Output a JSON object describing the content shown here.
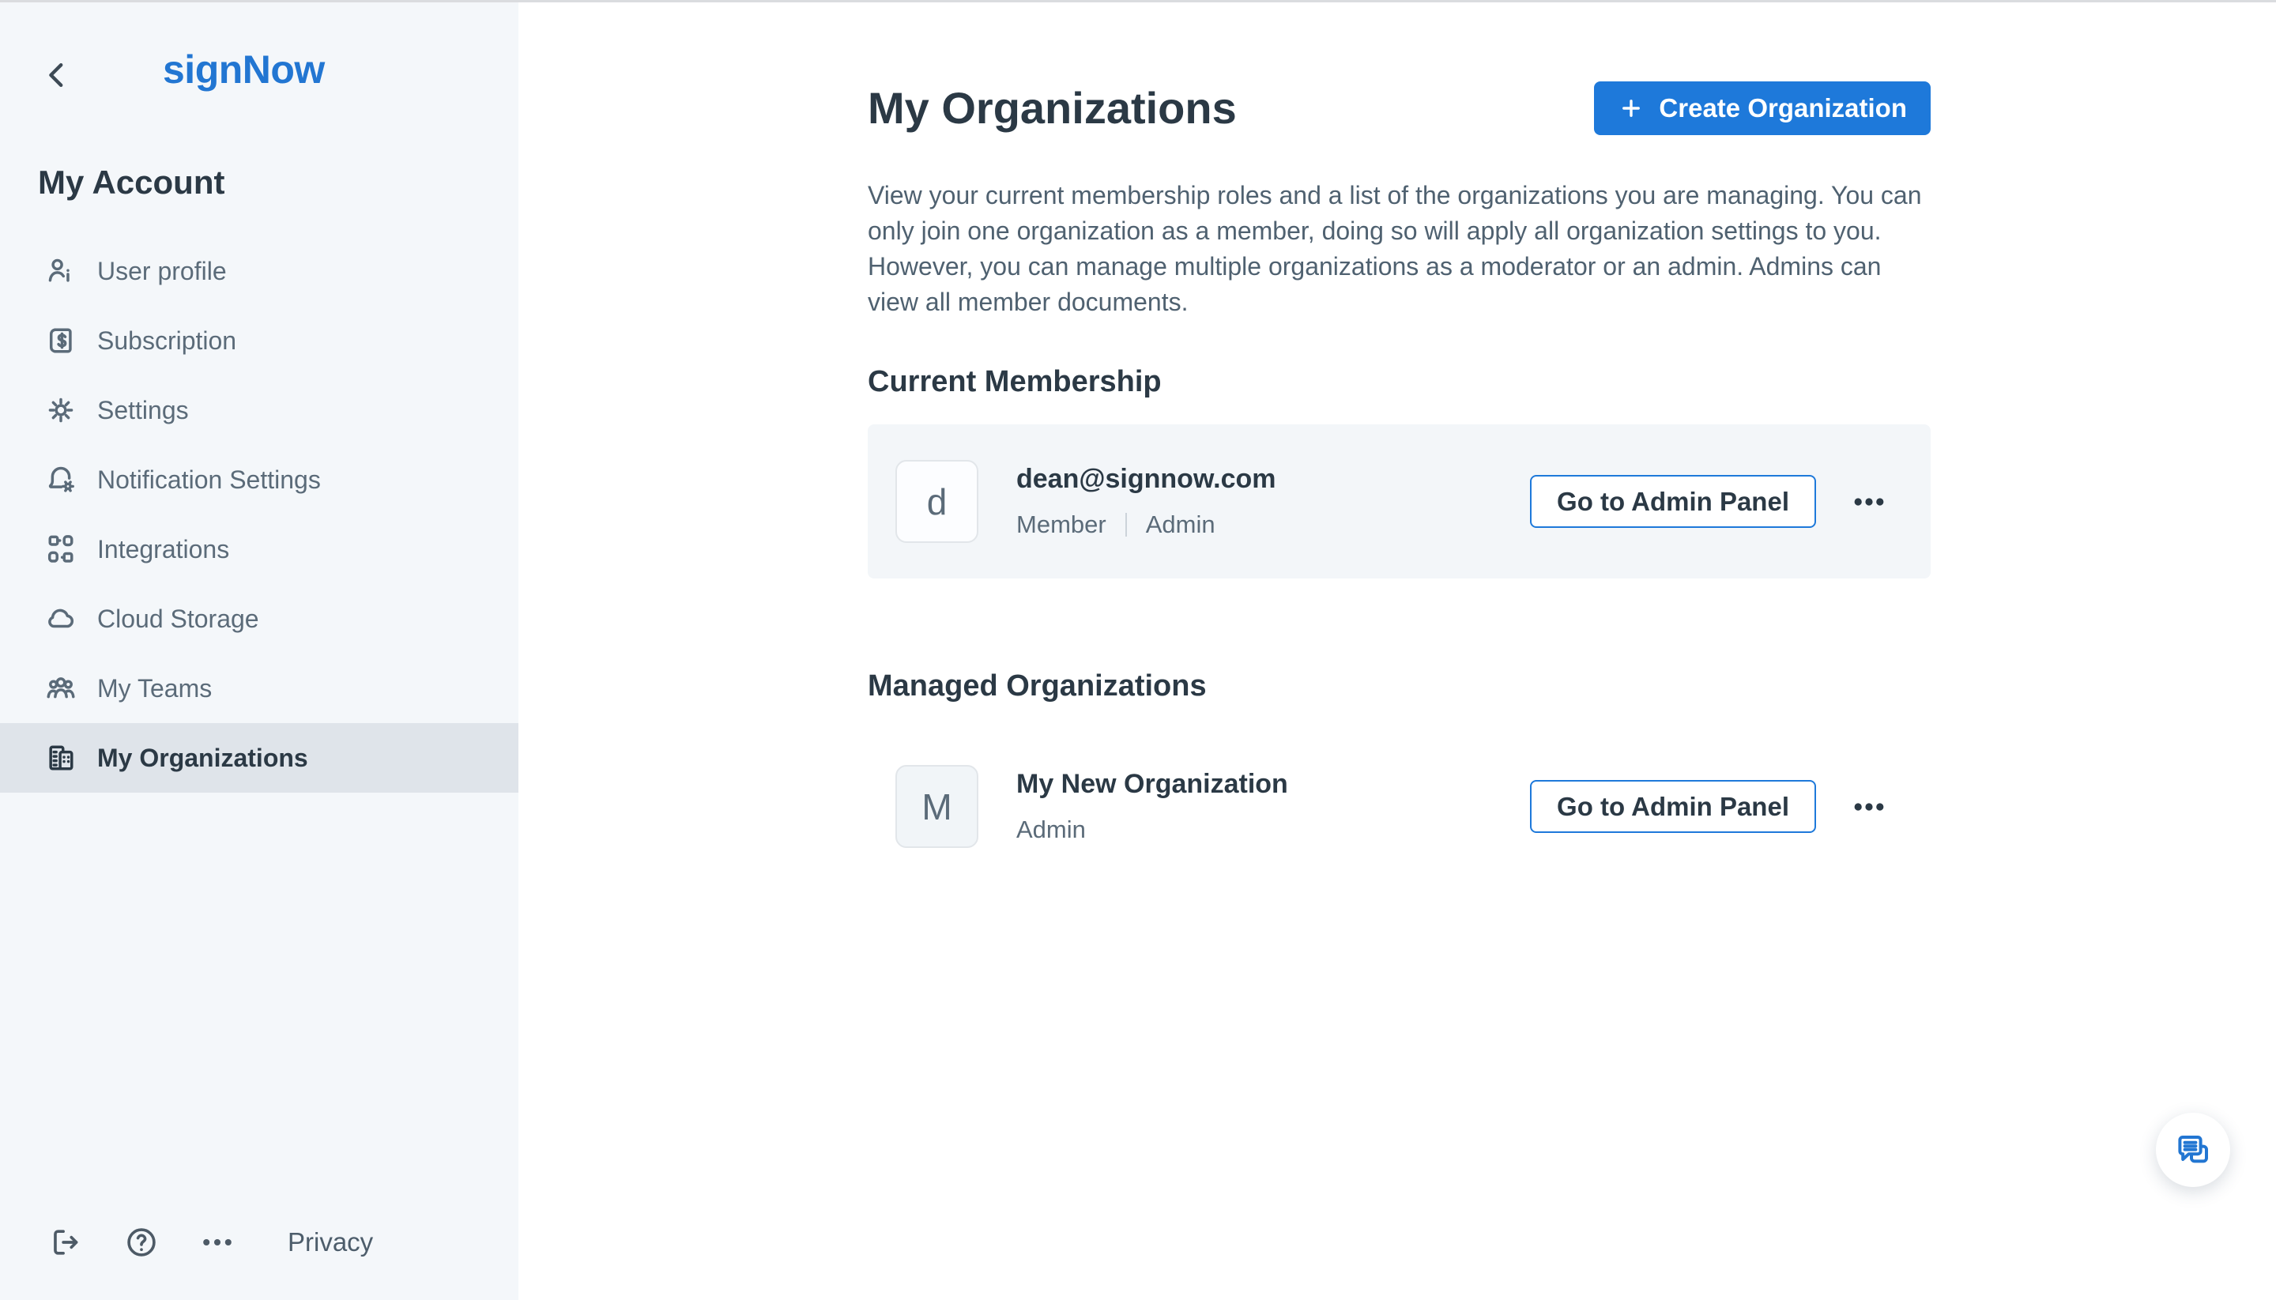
{
  "colors": {
    "accent_blue": "#1e79da",
    "logo_blue": "#2276d2",
    "sidebar_bg": "#f4f7fa",
    "selected_item_bg": "#dfe4ea",
    "card_bg": "#f3f6f9",
    "text_dark": "#2b3945",
    "text_gray": "#5b6b79"
  },
  "sidebar": {
    "logo": "signNow",
    "title": "My Account",
    "items": [
      {
        "label": "User profile",
        "icon": "user-profile-icon",
        "selected": false
      },
      {
        "label": "Subscription",
        "icon": "subscription-icon",
        "selected": false
      },
      {
        "label": "Settings",
        "icon": "settings-icon",
        "selected": false
      },
      {
        "label": "Notification Settings",
        "icon": "notification-settings-icon",
        "selected": false
      },
      {
        "label": "Integrations",
        "icon": "integrations-icon",
        "selected": false
      },
      {
        "label": "Cloud Storage",
        "icon": "cloud-storage-icon",
        "selected": false
      },
      {
        "label": "My Teams",
        "icon": "my-teams-icon",
        "selected": false
      },
      {
        "label": "My Organizations",
        "icon": "my-organizations-icon",
        "selected": true
      }
    ],
    "footer": {
      "icons": [
        "logout-icon",
        "help-icon",
        "more-dots-icon"
      ],
      "privacy_label": "Privacy"
    }
  },
  "main": {
    "title": "My Organizations",
    "create_button": {
      "label": "Create Organization",
      "icon": "plus-icon"
    },
    "description": "View your current membership roles and a list of the organizations you are managing. You can\nonly join one organization as a member, doing so will apply all organization settings to you.\nHowever, you can manage multiple organizations as a moderator or an admin. Admins can\nview all member documents.",
    "sections": [
      {
        "heading": "Current Membership",
        "rows": [
          {
            "avatar_letter": "d",
            "title": "dean@signnow.com",
            "roles": [
              "Member",
              "Admin"
            ],
            "action_label": "Go to Admin Panel",
            "more_icon": "ellipsis-icon"
          }
        ]
      },
      {
        "heading": "Managed Organizations",
        "rows": [
          {
            "avatar_letter": "M",
            "title": "My New Organization",
            "roles": [
              "Admin"
            ],
            "action_label": "Go to Admin Panel",
            "more_icon": "ellipsis-icon"
          }
        ]
      }
    ]
  },
  "fab": {
    "icon": "chat-icon"
  }
}
